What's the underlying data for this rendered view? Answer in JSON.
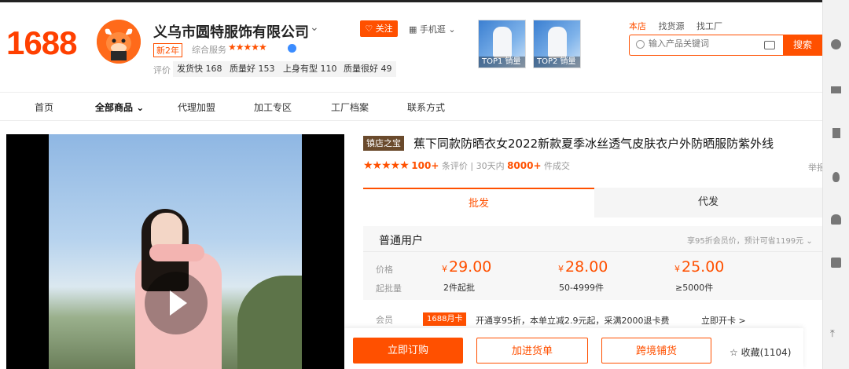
{
  "header": {
    "logo": "1688",
    "company_name": "义乌市圆特服饰有限公司",
    "years_badge": "新2年",
    "service_label": "综合服务",
    "service_stars": "★★★★★",
    "follow_label": "关注",
    "mobile_label": "手机逛",
    "eval_label": "评价",
    "eval_tags": [
      "发货快 168",
      "质量好 153",
      "上身有型 110",
      "质量很好 49"
    ],
    "promos": [
      {
        "rank": "TOP1 销量"
      },
      {
        "rank": "TOP2 销量"
      }
    ],
    "search_tabs": [
      "本店",
      "找货源",
      "找工厂"
    ],
    "search_placeholder": "输入产品关键词",
    "search_button": "搜索"
  },
  "nav": {
    "items": [
      "首页",
      "全部商品",
      "代理加盟",
      "加工专区",
      "工厂档案",
      "联系方式"
    ],
    "active_index": 1
  },
  "product": {
    "badge": "镇店之宝",
    "title": "蕉下同款防晒衣女2022新款夏季冰丝透气皮肤衣户外防晒服防紫外线",
    "stars": "★★★★★",
    "review_count": "100+",
    "review_suffix": "条评价",
    "sales_prefix": "30天内",
    "sales_count": "8000+",
    "sales_suffix": "件成交",
    "edge_text": "举报"
  },
  "mode_tabs": [
    "批发",
    "代发"
  ],
  "pricing": {
    "tier": "普通用户",
    "note": "享95折会员价，预计可省1199元",
    "price_label": "价格",
    "moq_label": "起批量",
    "currency": "¥",
    "prices": [
      "29.00",
      "28.00",
      "25.00"
    ],
    "moqs": [
      "2件起批",
      "50-4999件",
      "≥5000件"
    ]
  },
  "member": {
    "label": "会员",
    "badge": "1688月卡",
    "text": "开通享95折，本单立减2.9元起，采满2000退卡费",
    "link": "立即开卡 >"
  },
  "actions": {
    "buy": "立即订购",
    "cart": "加进货单",
    "cross": "跨境铺货",
    "favorite": "☆ 收藏(1104)"
  },
  "colors": {
    "brand": "#ff5000"
  }
}
